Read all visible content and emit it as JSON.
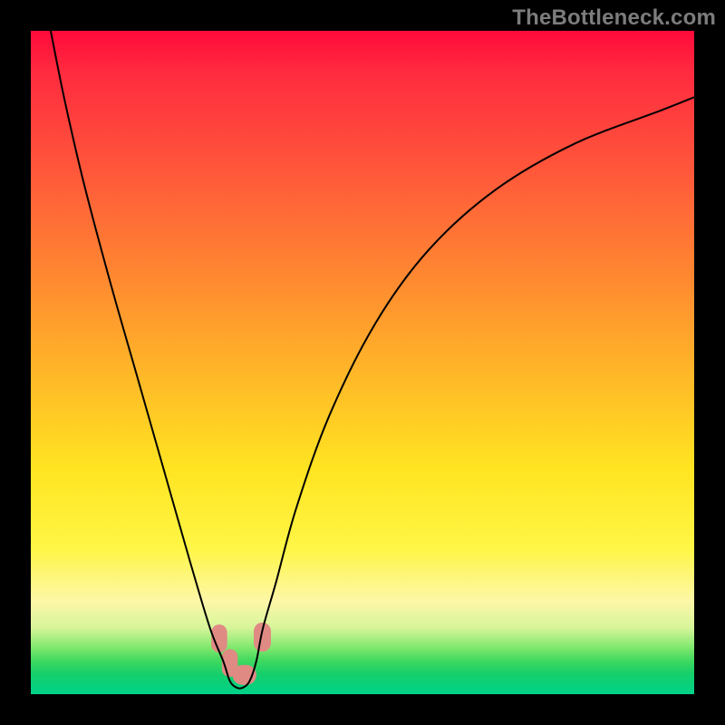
{
  "watermark": "TheBottleneck.com",
  "chart_data": {
    "type": "line",
    "title": "",
    "xlabel": "",
    "ylabel": "",
    "xlim": [
      0,
      100
    ],
    "ylim": [
      0,
      100
    ],
    "grid": false,
    "legend": false,
    "series": [
      {
        "name": "curve",
        "x": [
          3,
          5,
          8,
          12,
          16,
          20,
          24,
          27,
          29,
          30,
          31,
          32,
          33,
          34,
          35,
          37,
          40,
          45,
          52,
          60,
          70,
          82,
          95,
          100
        ],
        "y": [
          100,
          90,
          77,
          62,
          48,
          34,
          20,
          10,
          5,
          2,
          1,
          1,
          2,
          5,
          10,
          17,
          28,
          42,
          56,
          67,
          76,
          83,
          88,
          90
        ],
        "color": "#000000"
      }
    ],
    "annotations": [
      {
        "type": "highlight-band",
        "x_range": [
          27,
          35
        ],
        "y_range": [
          0,
          10
        ],
        "color": "#e28b86"
      }
    ],
    "background_gradient": {
      "direction": "vertical",
      "stops": [
        {
          "pos": 0.0,
          "color": "#ff0a3a"
        },
        {
          "pos": 0.22,
          "color": "#ff5a3a"
        },
        {
          "pos": 0.52,
          "color": "#ffb828"
        },
        {
          "pos": 0.78,
          "color": "#fff646"
        },
        {
          "pos": 0.9,
          "color": "#d6f59a"
        },
        {
          "pos": 1.0,
          "color": "#00d28a"
        }
      ]
    }
  }
}
